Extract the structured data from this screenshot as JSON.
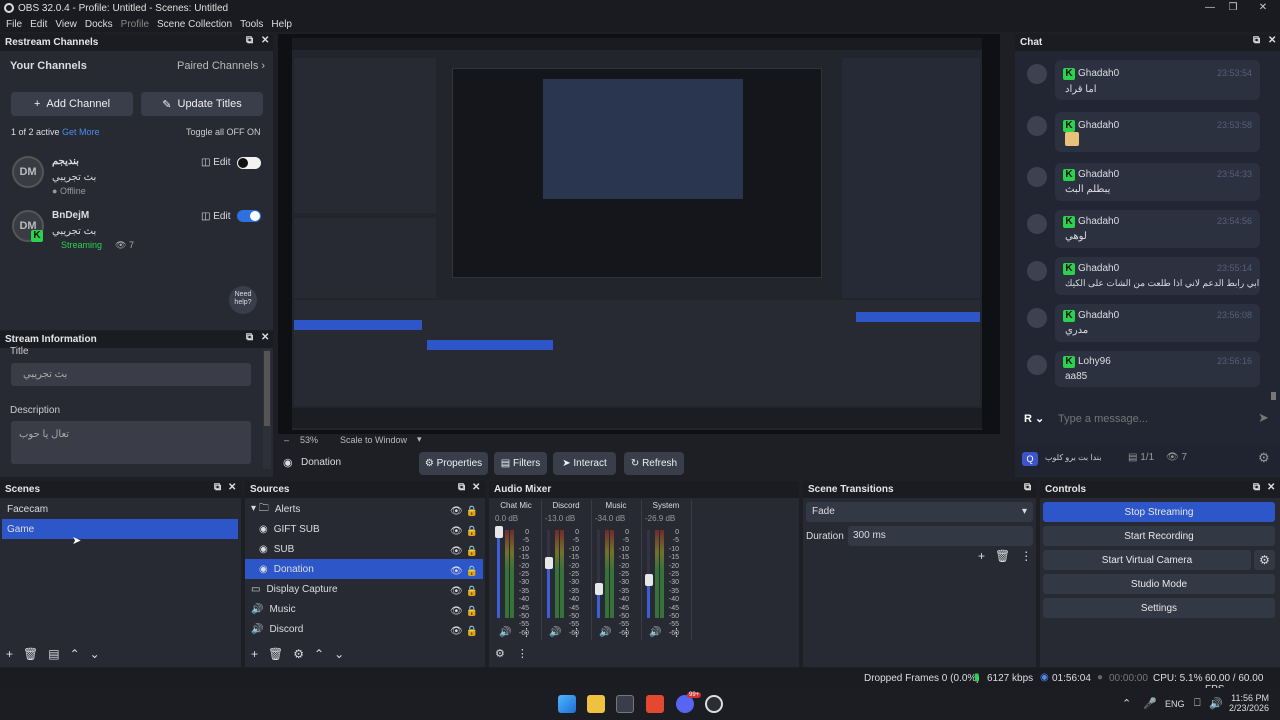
{
  "window": {
    "title": "OBS 32.0.4 - Profile: Untitled - Scenes: Untitled",
    "controls": [
      "—",
      "❒",
      "✕"
    ]
  },
  "menu": [
    "File",
    "Edit",
    "View",
    "Docks",
    "Profile",
    "Scene Collection",
    "Tools",
    "Help"
  ],
  "restream": {
    "title": "Restream Channels",
    "your_channels": "Your Channels",
    "paired_channels": "Paired Channels",
    "add_channel": "Add Channel",
    "update_titles": "Update Titles",
    "active_count": "1 of 2 active",
    "get_more": "Get More",
    "toggle_all": "Toggle all OFF",
    "on_label": "ON",
    "channels": [
      {
        "name": "بنديجم",
        "title": "بث تجريبي",
        "status": "Offline",
        "edit": "Edit",
        "enabled": false
      },
      {
        "name": "BnDejM",
        "title": "بث تجريبي",
        "status": "Streaming",
        "viewers": "7",
        "edit": "Edit",
        "enabled": true
      }
    ],
    "need_help": "Need help?"
  },
  "stream_info": {
    "title": "Stream Information",
    "title_label": "Title",
    "title_value": "بث تجريبي",
    "description_label": "Description",
    "description_value": "تعال يا حوب"
  },
  "preview_bar": {
    "zoom": "53%",
    "scale": "Scale to Window"
  },
  "source_toolbar": {
    "source": "Donation",
    "properties": "Properties",
    "filters": "Filters",
    "interact": "Interact",
    "refresh": "Refresh"
  },
  "chat": {
    "title": "Chat",
    "messages": [
      {
        "user": "Ghadah0",
        "time": "23:53:54",
        "text": "اما قراد"
      },
      {
        "user": "Ghadah0",
        "time": "23:53:58",
        "text": ""
      },
      {
        "user": "Ghadah0",
        "time": "23:54:33",
        "text": "يبطلم البث"
      },
      {
        "user": "Ghadah0",
        "time": "23:54:56",
        "text": "لوهي"
      },
      {
        "user": "Ghadah0",
        "time": "23:55:14",
        "text": "ابي رابط الدعم لاني اذا طلعت من الشات على الكيك"
      },
      {
        "user": "Ghadah0",
        "time": "23:56:08",
        "text": "مدري"
      },
      {
        "user": "Lohy96",
        "time": "23:56:16",
        "text": "aa85"
      }
    ],
    "placeholder": "Type a message...",
    "footer_channel": "بندا بت برو كلوب",
    "footer_count": "1/1",
    "footer_viewers": "7"
  },
  "scenes": {
    "title": "Scenes",
    "items": [
      "Facecam",
      "Game"
    ],
    "selected": "Game"
  },
  "sources": {
    "title": "Sources",
    "items": [
      "Alerts",
      "GIFT SUB",
      "SUB",
      "Donation",
      "Display Capture",
      "Music",
      "Discord"
    ],
    "selected": "Donation"
  },
  "mixer": {
    "title": "Audio Mixer",
    "channels": [
      {
        "name": "Chat Mic",
        "db": "0.0 dB",
        "level": 1.0
      },
      {
        "name": "Discord",
        "db": "-13.0 dB",
        "level": 0.65
      },
      {
        "name": "Music",
        "db": "-34.0 dB",
        "level": 0.35
      },
      {
        "name": "System",
        "db": "-26.9 dB",
        "level": 0.45
      }
    ],
    "scale": [
      "0",
      "-5",
      "-10",
      "-15",
      "-20",
      "-25",
      "-30",
      "-35",
      "-40",
      "-45",
      "-50",
      "-55",
      "-60"
    ]
  },
  "transitions": {
    "title": "Scene Transitions",
    "type": "Fade",
    "duration_label": "Duration",
    "duration": "300 ms"
  },
  "controls": {
    "title": "Controls",
    "buttons": [
      "Stop Streaming",
      "Start Recording",
      "Start Virtual Camera",
      "Studio Mode",
      "Settings"
    ]
  },
  "status": {
    "dropped": "Dropped Frames 0 (0.0%)",
    "kbps": "6127 kbps",
    "stream_time": "01:56:04",
    "rec_time": "00:00:00",
    "cpu": "CPU: 5.1%",
    "fps": "60.00 / 60.00 FPS"
  },
  "taskbar": {
    "lang": "ENG",
    "time": "11:56 PM",
    "date": "2/23/2026",
    "badge": "99+"
  },
  "colors": {
    "accent": "#2d56c8",
    "streaming": "#2bd24b",
    "panel": "#272a33"
  }
}
